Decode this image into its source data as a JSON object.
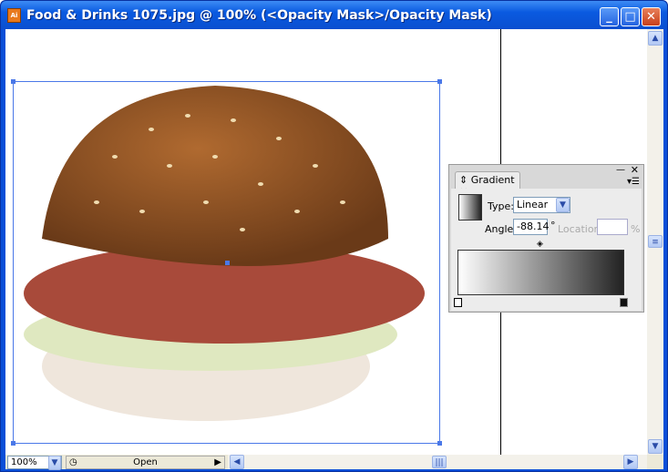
{
  "window": {
    "title": "Food & Drinks 1075.jpg @ 100% (<Opacity Mask>/Opacity Mask)",
    "app_icon": "Ai"
  },
  "controls": {
    "minimize": "_",
    "maximize": "□",
    "close": "✕"
  },
  "status": {
    "zoom": "100%",
    "status_label": "Open"
  },
  "gradient_panel": {
    "tab": "Gradient",
    "type_label": "Type:",
    "type_value": "Linear",
    "angle_label": "Angle:",
    "angle_value": "-88.14",
    "degree": "°",
    "location_label": "Location:",
    "location_value": "",
    "percent": "%"
  }
}
